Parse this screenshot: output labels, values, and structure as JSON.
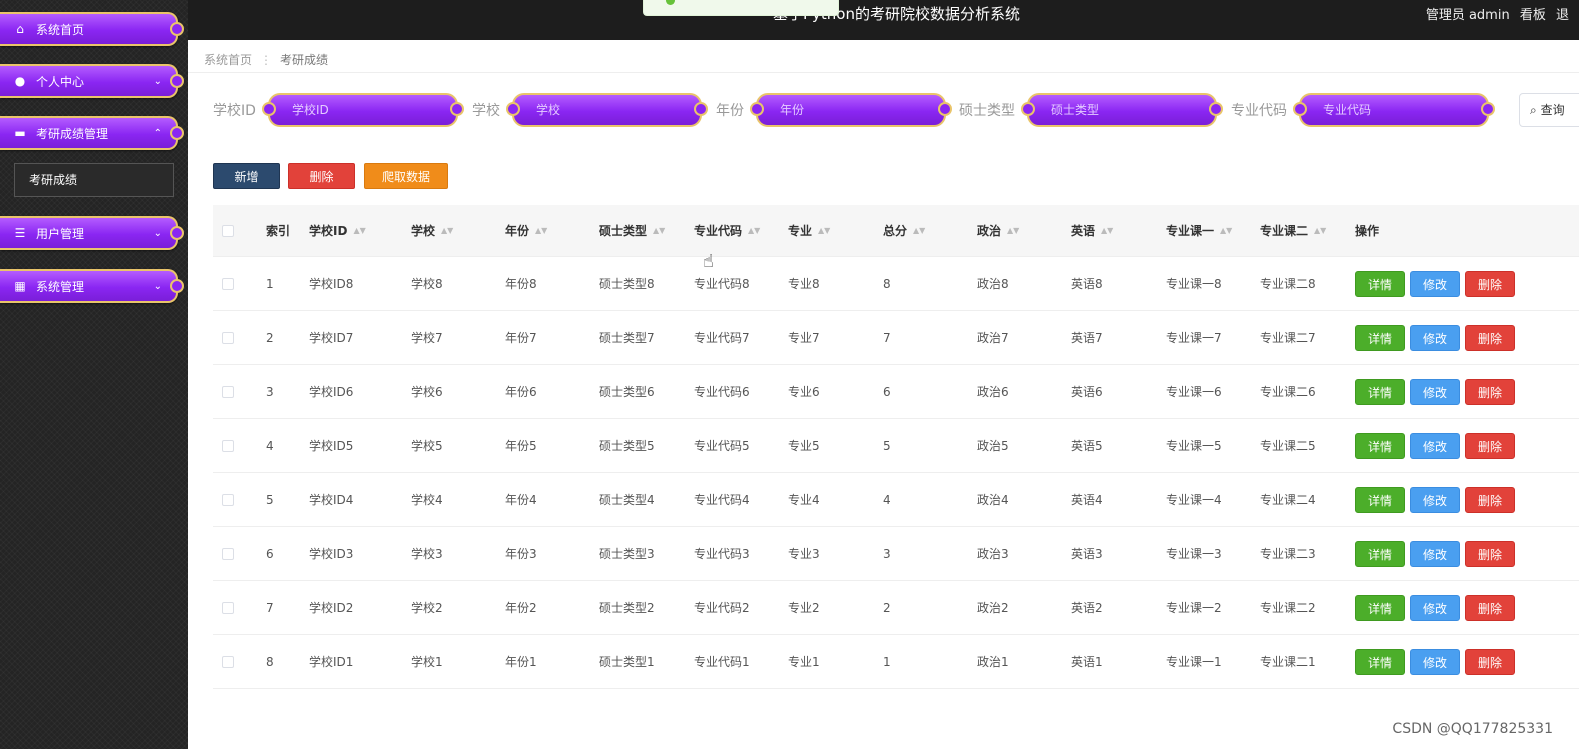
{
  "header": {
    "title": "基于Python的考研院校数据分析系统",
    "user_label": "管理员 admin",
    "dashboard_link": "看板",
    "logout_link": "退"
  },
  "sidebar": {
    "items": [
      {
        "label": "系统首页",
        "icon": "home-icon"
      },
      {
        "label": "个人中心",
        "icon": "user-icon"
      },
      {
        "label": "考研成绩管理",
        "icon": "briefcase-icon"
      },
      {
        "label": "用户管理",
        "icon": "list-icon"
      },
      {
        "label": "系统管理",
        "icon": "grid-icon"
      }
    ],
    "submenu_item": "考研成绩"
  },
  "breadcrumb": {
    "home": "系统首页",
    "current": "考研成绩"
  },
  "search": {
    "fields": [
      {
        "label": "学校ID",
        "placeholder": "学校ID"
      },
      {
        "label": "学校",
        "placeholder": "学校"
      },
      {
        "label": "年份",
        "placeholder": "年份"
      },
      {
        "label": "硕士类型",
        "placeholder": "硕士类型"
      },
      {
        "label": "专业代码",
        "placeholder": "专业代码"
      }
    ],
    "query_button": "查询"
  },
  "actions": {
    "add": "新增",
    "delete": "删除",
    "crawl": "爬取数据"
  },
  "table": {
    "headers": [
      "索引",
      "学校ID",
      "学校",
      "年份",
      "硕士类型",
      "专业代码",
      "专业",
      "总分",
      "政治",
      "英语",
      "专业课一",
      "专业课二",
      "操作"
    ],
    "row_actions": {
      "detail": "详情",
      "edit": "修改",
      "delete": "删除"
    },
    "rows": [
      [
        "1",
        "学校ID8",
        "学校8",
        "年份8",
        "硕士类型8",
        "专业代码8",
        "专业8",
        "8",
        "政治8",
        "英语8",
        "专业课一8",
        "专业课二8"
      ],
      [
        "2",
        "学校ID7",
        "学校7",
        "年份7",
        "硕士类型7",
        "专业代码7",
        "专业7",
        "7",
        "政治7",
        "英语7",
        "专业课一7",
        "专业课二7"
      ],
      [
        "3",
        "学校ID6",
        "学校6",
        "年份6",
        "硕士类型6",
        "专业代码6",
        "专业6",
        "6",
        "政治6",
        "英语6",
        "专业课一6",
        "专业课二6"
      ],
      [
        "4",
        "学校ID5",
        "学校5",
        "年份5",
        "硕士类型5",
        "专业代码5",
        "专业5",
        "5",
        "政治5",
        "英语5",
        "专业课一5",
        "专业课二5"
      ],
      [
        "5",
        "学校ID4",
        "学校4",
        "年份4",
        "硕士类型4",
        "专业代码4",
        "专业4",
        "4",
        "政治4",
        "英语4",
        "专业课一4",
        "专业课二4"
      ],
      [
        "6",
        "学校ID3",
        "学校3",
        "年份3",
        "硕士类型3",
        "专业代码3",
        "专业3",
        "3",
        "政治3",
        "英语3",
        "专业课一3",
        "专业课二3"
      ],
      [
        "7",
        "学校ID2",
        "学校2",
        "年份2",
        "硕士类型2",
        "专业代码2",
        "专业2",
        "2",
        "政治2",
        "英语2",
        "专业课一2",
        "专业课二2"
      ],
      [
        "8",
        "学校ID1",
        "学校1",
        "年份1",
        "硕士类型1",
        "专业代码1",
        "专业1",
        "1",
        "政治1",
        "英语1",
        "专业课一1",
        "专业课二1"
      ]
    ]
  },
  "watermark": "CSDN @QQ177825331",
  "colors": {
    "menu_purple": "#8a26f2",
    "menu_border_gold": "#e9c46a",
    "add_button": "#2c4a6e",
    "delete_button": "#e2423a",
    "crawl_button": "#f08c1a",
    "detail_button": "#4cae2a",
    "edit_button": "#4a9ff0"
  }
}
